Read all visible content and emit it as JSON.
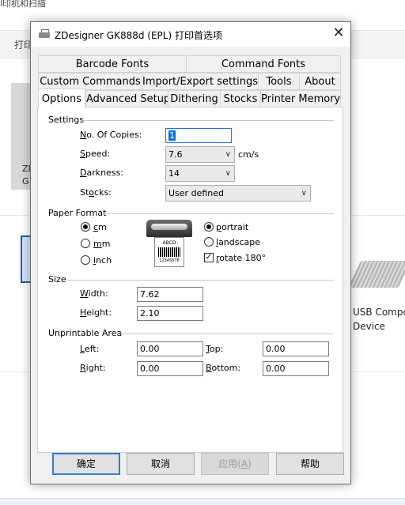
{
  "background": {
    "top_fragment": "l印机和扫描",
    "bar_fragment": "打印",
    "tile_lines": [
      "ZD",
      "G"
    ],
    "usb_device": [
      "USB Compo",
      "Device"
    ]
  },
  "dialog": {
    "title": "ZDesigner GK888d (EPL) 打印首选项",
    "close_glyph": "✕",
    "tabs_row1": [
      "Barcode Fonts",
      "Command Fonts"
    ],
    "tabs_row2": [
      "Custom Commands",
      "Import/Export settings",
      "Tools",
      "About"
    ],
    "tabs_row3": [
      "Options",
      "Advanced Setup",
      "Dithering",
      "Stocks",
      "Printer Memory"
    ],
    "active_tab": "Options",
    "settings": {
      "group_label": "Settings",
      "copies": {
        "label_u": "N",
        "label_rest": "o. Of Copies:",
        "value": "1"
      },
      "speed": {
        "label_u": "S",
        "label_rest": "peed:",
        "value": "7.6",
        "unit": "cm/s"
      },
      "darkness": {
        "label_u": "D",
        "label_rest": "arkness:",
        "value": "14"
      },
      "stocks": {
        "label_pre": "St",
        "label_u": "o",
        "label_rest": "cks:",
        "value": "User defined"
      }
    },
    "paper_format": {
      "group_label": "Paper Format",
      "units": [
        {
          "u": "c",
          "rest": "m",
          "selected": true
        },
        {
          "u": "m",
          "rest": "m",
          "selected": false
        },
        {
          "u": "i",
          "rest": "nch",
          "selected": false
        }
      ],
      "orientation": [
        {
          "u": "p",
          "rest": "ortrait",
          "selected": true
        },
        {
          "u": "l",
          "rest": "andscape",
          "selected": false
        }
      ],
      "rotate": {
        "u": "r",
        "rest": "otate 180°",
        "checked": true
      },
      "preview_text": "ABCD",
      "preview_code": "12345678"
    },
    "size": {
      "group_label": "Size",
      "width": {
        "label_u": "W",
        "label_rest": "idth:",
        "value": "7.62"
      },
      "height": {
        "label_u": "H",
        "label_rest": "eight:",
        "value": "2.10"
      }
    },
    "unprintable": {
      "group_label": "Unprintable Area",
      "left": {
        "label_u": "L",
        "label_rest": "eft:",
        "value": "0.00"
      },
      "top": {
        "label_u": "T",
        "label_rest": "op:",
        "value": "0.00"
      },
      "right": {
        "label_u": "R",
        "label_rest": "ight:",
        "value": "0.00"
      },
      "bottom": {
        "label_u": "B",
        "label_rest": "ottom:",
        "value": "0.00"
      }
    },
    "buttons": {
      "ok": "确定",
      "cancel": "取消",
      "apply_pre": "应用(",
      "apply_u": "A",
      "apply_post": ")",
      "help": "帮助"
    }
  }
}
